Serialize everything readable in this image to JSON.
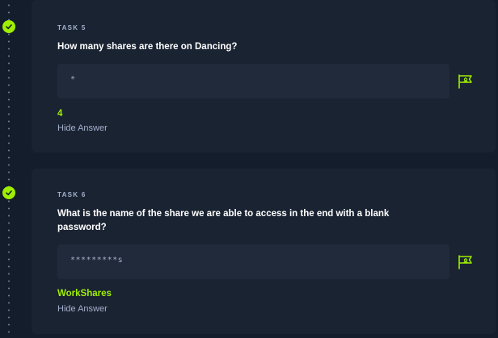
{
  "tasks": [
    {
      "label": "TASK 5",
      "question": "How many shares are there on Dancing?",
      "answer_mask": "*",
      "answer": "4",
      "hide_answer_label": "Hide Answer",
      "completed": true
    },
    {
      "label": "TASK 6",
      "question": "What is the name of the share we are able to access in the end with a blank password?",
      "answer_mask": "*********s",
      "answer": "WorkShares",
      "hide_answer_label": "Hide Answer",
      "completed": true
    }
  ],
  "colors": {
    "accent": "#9fef00",
    "background": "#141d2b",
    "card": "#1a2332",
    "input": "#202a3a",
    "muted_text": "#a4b1cd"
  },
  "icons": {
    "completed": "check-circle-icon",
    "submit": "flag-icon"
  }
}
